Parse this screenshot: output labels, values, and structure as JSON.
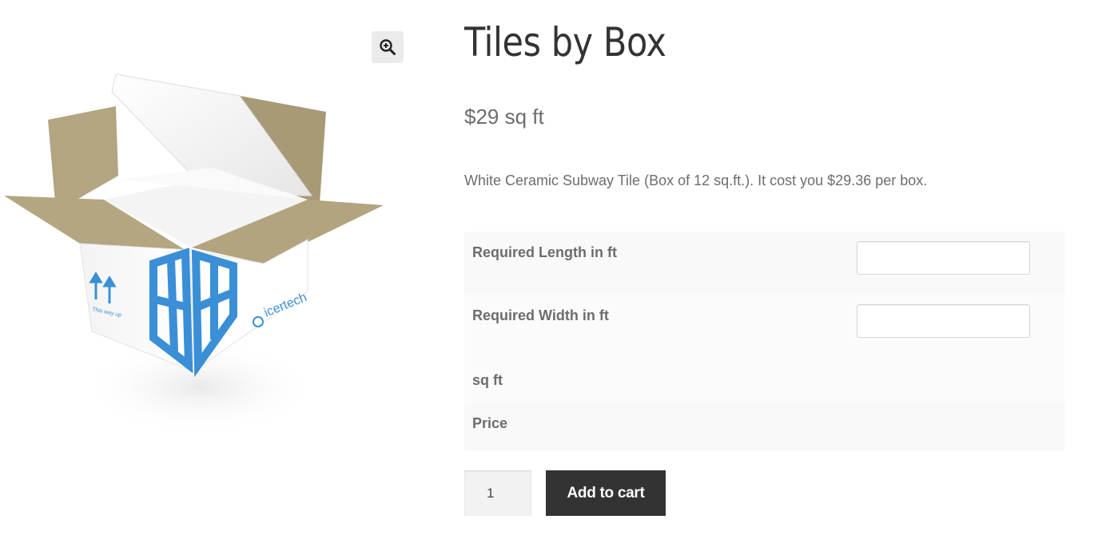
{
  "product": {
    "title": "Tiles by Box",
    "price": "$29 sq ft",
    "description": "White Ceramic Subway Tile (Box of 12 sq.ft.). It cost you $29.36 per box."
  },
  "gallery": {
    "zoom_icon": "magnifier-plus-icon",
    "image_brand_text": "icertech",
    "image_arrow_text": "This way up"
  },
  "calculator": {
    "rows": [
      {
        "label": "Required Length in ft",
        "value": ""
      },
      {
        "label": "Required Width in ft",
        "value": ""
      },
      {
        "label": "sq ft"
      },
      {
        "label": "Price"
      }
    ]
  },
  "cart": {
    "quantity": "1",
    "add_to_cart_label": "Add to cart"
  },
  "colors": {
    "button_bg": "#333333",
    "button_text": "#ffffff",
    "text": "#6d6d6d",
    "title": "#333333",
    "box_blue": "#3a8fd6",
    "cardboard": "#b6a884"
  }
}
